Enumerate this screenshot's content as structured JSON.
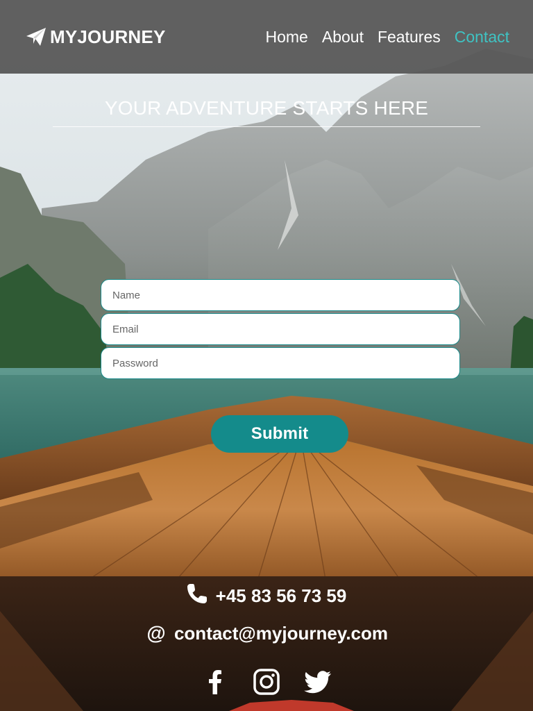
{
  "brand": {
    "name": "MYJOURNEY",
    "icon": "paper-plane-icon"
  },
  "nav": {
    "items": [
      {
        "label": "Home",
        "active": false
      },
      {
        "label": "About",
        "active": false
      },
      {
        "label": "Features",
        "active": false
      },
      {
        "label": "Contact",
        "active": true
      }
    ]
  },
  "hero": {
    "title": "YOUR ADVENTURE STARTS HERE"
  },
  "form": {
    "name_placeholder": "Name",
    "email_placeholder": "Email",
    "password_placeholder": "Password",
    "submit_label": "Submit"
  },
  "contact": {
    "phone_icon": "phone-icon",
    "phone": "+45 83 56 73 59",
    "email_symbol": "@",
    "email": "contact@myjourney.com"
  },
  "social": [
    {
      "icon": "facebook-icon"
    },
    {
      "icon": "instagram-icon"
    },
    {
      "icon": "twitter-icon"
    }
  ],
  "colors": {
    "accent": "#3fc3c3",
    "button": "#148b8b",
    "field_border": "#1b8a8a",
    "navbar": "#555555"
  }
}
